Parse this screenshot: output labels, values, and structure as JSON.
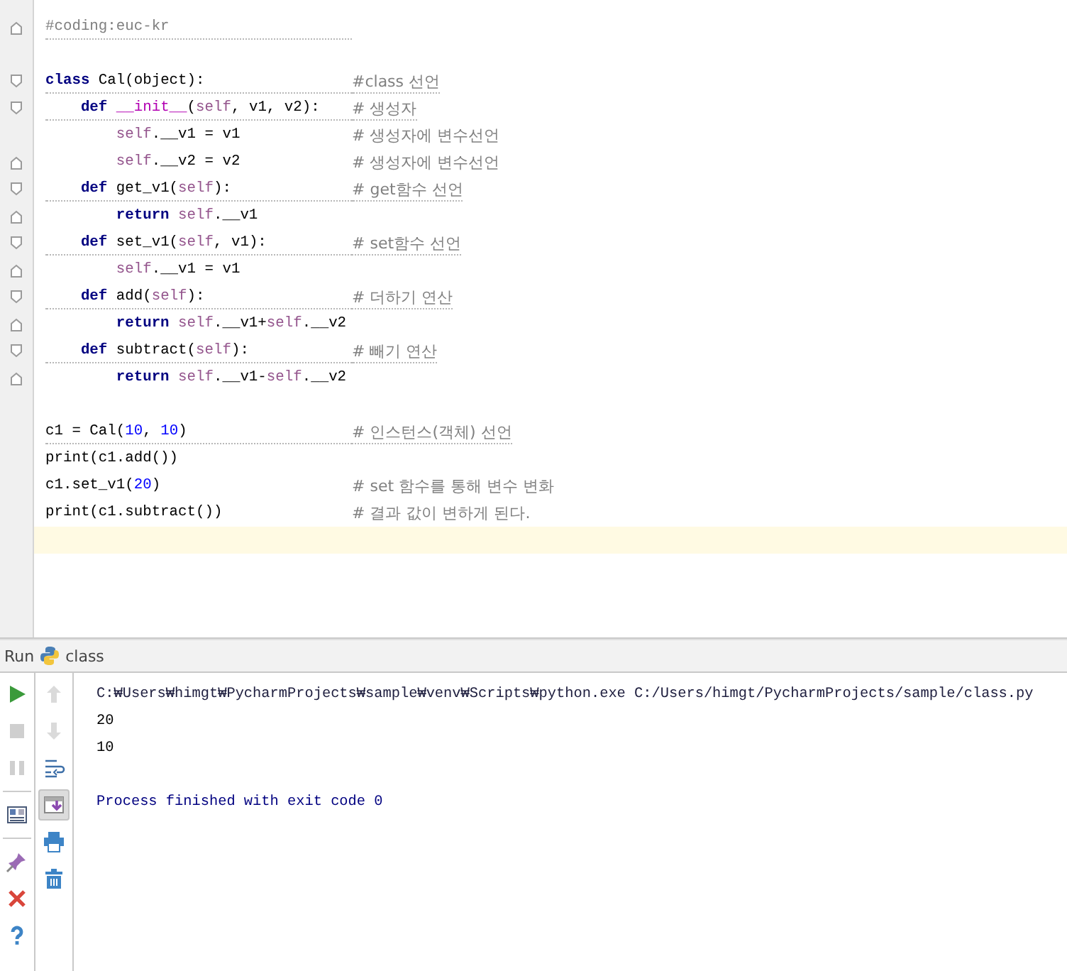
{
  "editor": {
    "lines": [
      {
        "fold_start": false,
        "fold_end": true,
        "warning": true,
        "current": false,
        "tokens": [
          {
            "kind": "comment",
            "text": "#coding:euc-kr"
          }
        ]
      },
      {
        "fold_start": false,
        "fold_end": false,
        "warning": false,
        "current": false
      },
      {
        "fold_start": true,
        "fold_end": false,
        "warning": true,
        "current": false,
        "tokens": [
          {
            "kind": "keyword",
            "text": "class "
          },
          {
            "kind": "plain",
            "text": "Cal(object):"
          }
        ],
        "comment": "#class 선언"
      },
      {
        "fold_start": true,
        "fold_end": false,
        "warning": true,
        "current": false,
        "tokens": [
          {
            "kind": "keyword",
            "text": "    def "
          },
          {
            "kind": "dunder",
            "text": "__init__"
          },
          {
            "kind": "plain",
            "text": "("
          },
          {
            "kind": "self",
            "text": "self"
          },
          {
            "kind": "plain",
            "text": ", v1, v2):"
          }
        ],
        "comment": "# 생성자"
      },
      {
        "fold_start": false,
        "fold_end": false,
        "warning": false,
        "current": false,
        "tokens": [
          {
            "kind": "self",
            "text": "        self"
          },
          {
            "kind": "plain",
            "text": ".__v1 = v1"
          }
        ],
        "comment": "# 생성자에 변수선언"
      },
      {
        "fold_start": false,
        "fold_end": true,
        "warning": false,
        "current": false,
        "tokens": [
          {
            "kind": "self",
            "text": "        self"
          },
          {
            "kind": "plain",
            "text": ".__v2 = v2"
          }
        ],
        "comment": "# 생성자에 변수선언"
      },
      {
        "fold_start": true,
        "fold_end": false,
        "warning": true,
        "current": false,
        "tokens": [
          {
            "kind": "keyword",
            "text": "    def "
          },
          {
            "kind": "plain",
            "text": "get_v1("
          },
          {
            "kind": "self",
            "text": "self"
          },
          {
            "kind": "plain",
            "text": "):"
          }
        ],
        "comment": "# get함수 선언"
      },
      {
        "fold_start": false,
        "fold_end": true,
        "warning": false,
        "current": false,
        "tokens": [
          {
            "kind": "keyword",
            "text": "        return "
          },
          {
            "kind": "self",
            "text": "self"
          },
          {
            "kind": "plain",
            "text": ".__v1"
          }
        ]
      },
      {
        "fold_start": true,
        "fold_end": false,
        "warning": true,
        "current": false,
        "tokens": [
          {
            "kind": "keyword",
            "text": "    def "
          },
          {
            "kind": "plain",
            "text": "set_v1("
          },
          {
            "kind": "self",
            "text": "self"
          },
          {
            "kind": "plain",
            "text": ", v1):"
          }
        ],
        "comment": "# set함수 선언"
      },
      {
        "fold_start": false,
        "fold_end": true,
        "warning": false,
        "current": false,
        "tokens": [
          {
            "kind": "self",
            "text": "        self"
          },
          {
            "kind": "plain",
            "text": ".__v1 = v1"
          }
        ]
      },
      {
        "fold_start": true,
        "fold_end": false,
        "warning": true,
        "current": false,
        "tokens": [
          {
            "kind": "keyword",
            "text": "    def "
          },
          {
            "kind": "plain",
            "text": "add("
          },
          {
            "kind": "self",
            "text": "self"
          },
          {
            "kind": "plain",
            "text": "):"
          }
        ],
        "comment": "# 더하기 연산"
      },
      {
        "fold_start": false,
        "fold_end": true,
        "warning": false,
        "current": false,
        "tokens": [
          {
            "kind": "keyword",
            "text": "        return "
          },
          {
            "kind": "self",
            "text": "self"
          },
          {
            "kind": "plain",
            "text": ".__v1+"
          },
          {
            "kind": "self",
            "text": "self"
          },
          {
            "kind": "plain",
            "text": ".__v2"
          }
        ]
      },
      {
        "fold_start": true,
        "fold_end": false,
        "warning": true,
        "current": false,
        "tokens": [
          {
            "kind": "keyword",
            "text": "    def "
          },
          {
            "kind": "plain",
            "text": "subtract("
          },
          {
            "kind": "self",
            "text": "self"
          },
          {
            "kind": "plain",
            "text": "):"
          }
        ],
        "comment": "# 빼기 연산"
      },
      {
        "fold_start": false,
        "fold_end": true,
        "warning": false,
        "current": false,
        "tokens": [
          {
            "kind": "keyword",
            "text": "        return "
          },
          {
            "kind": "self",
            "text": "self"
          },
          {
            "kind": "plain",
            "text": ".__v1-"
          },
          {
            "kind": "self",
            "text": "self"
          },
          {
            "kind": "plain",
            "text": ".__v2"
          }
        ]
      },
      {
        "fold_start": false,
        "fold_end": false,
        "warning": false,
        "current": false
      },
      {
        "fold_start": false,
        "fold_end": false,
        "warning": true,
        "current": false,
        "tokens": [
          {
            "kind": "plain",
            "text": "c1 = Cal("
          },
          {
            "kind": "number",
            "text": "10"
          },
          {
            "kind": "plain",
            "text": ", "
          },
          {
            "kind": "number",
            "text": "10"
          },
          {
            "kind": "plain",
            "text": ")"
          }
        ],
        "comment": "# 인스턴스(객체) 선언"
      },
      {
        "fold_start": false,
        "fold_end": false,
        "warning": false,
        "current": false,
        "tokens": [
          {
            "kind": "plain",
            "text": "print(c1.add())"
          }
        ]
      },
      {
        "fold_start": false,
        "fold_end": false,
        "warning": false,
        "current": false,
        "tokens": [
          {
            "kind": "plain",
            "text": "c1.set_v1("
          },
          {
            "kind": "number",
            "text": "20"
          },
          {
            "kind": "plain",
            "text": ")"
          }
        ],
        "comment": "# set 함수를 통해 변수 변화"
      },
      {
        "fold_start": false,
        "fold_end": false,
        "warning": false,
        "current": false,
        "tokens": [
          {
            "kind": "plain",
            "text": "print(c1.subtract())"
          }
        ],
        "comment": "# 결과 값이 변하게 된다."
      },
      {
        "fold_start": false,
        "fold_end": false,
        "warning": false,
        "current": true
      }
    ]
  },
  "run_panel": {
    "label": "Run",
    "config": "class",
    "left_tools": [
      {
        "kind": "run",
        "disabled": false
      },
      {
        "kind": "stop",
        "disabled": true
      },
      {
        "kind": "pause",
        "disabled": true
      },
      {
        "kind": "layout",
        "disabled": false
      },
      {
        "kind": "pin",
        "disabled": false
      },
      {
        "kind": "close",
        "disabled": false
      },
      {
        "kind": "help",
        "disabled": false
      }
    ],
    "right_tools": [
      {
        "kind": "up",
        "disabled": true,
        "on": false
      },
      {
        "kind": "down",
        "disabled": true,
        "on": false
      },
      {
        "kind": "wrap",
        "disabled": false,
        "on": false
      },
      {
        "kind": "scroll-end",
        "disabled": false,
        "on": true
      },
      {
        "kind": "print",
        "disabled": false,
        "on": false
      },
      {
        "kind": "clear",
        "disabled": false,
        "on": false
      }
    ],
    "console": [
      {
        "kind": "command",
        "text": "C:₩Users₩himgt₩PycharmProjects₩sample₩venv₩Scripts₩python.exe C:/Users/himgt/PycharmProjects/sample/class.py"
      },
      {
        "kind": "output",
        "text": "20"
      },
      {
        "kind": "output",
        "text": "10"
      },
      {
        "kind": "system",
        "text": "Process finished with exit code 0"
      }
    ]
  }
}
